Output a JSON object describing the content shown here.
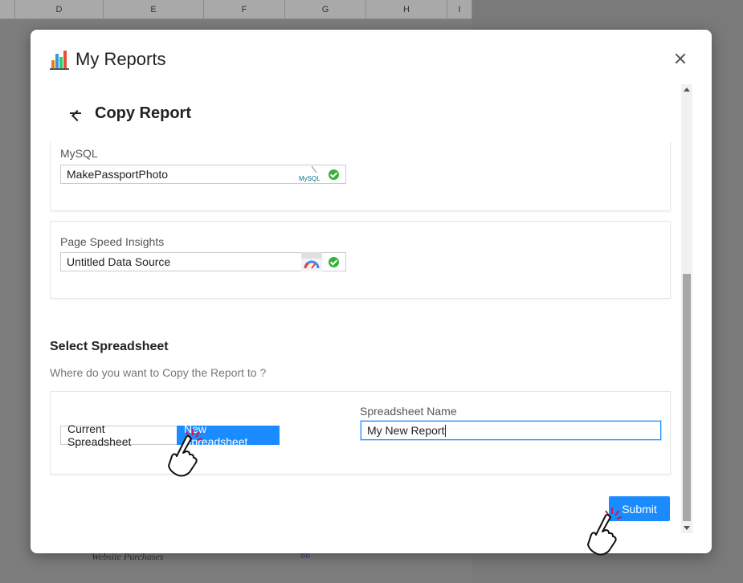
{
  "spreadsheet": {
    "columns": [
      "D",
      "E",
      "F",
      "G",
      "H",
      "I"
    ],
    "bg_row_label": "Website Purchases",
    "bg_row_value": "86"
  },
  "modal": {
    "title": "My Reports",
    "title_icon": "bar-chart-icon",
    "close_icon": "close-icon"
  },
  "copy_report": {
    "back_icon": "back-arrow-icon",
    "title": "Copy Report",
    "data_sources": [
      {
        "label": "MySQL",
        "value": "MakePassportPhoto",
        "logo": "mysql-logo",
        "logo_text": "MySQL",
        "status": "connected"
      },
      {
        "label": "Page Speed Insights",
        "value": "Untitled Data Source",
        "logo": "page-speed-logo",
        "status": "connected"
      }
    ]
  },
  "select_spreadsheet": {
    "title": "Select Spreadsheet",
    "subtitle": "Where do you want to Copy the Report to ?",
    "option_current": "Current Spreadsheet",
    "option_new": "New Spreadsheet",
    "selected": "New Spreadsheet",
    "name_label": "Spreadsheet Name",
    "name_value": "My New Report"
  },
  "submit_label": "Submit",
  "colors": {
    "accent": "#1a8cff",
    "check": "#34b233"
  }
}
